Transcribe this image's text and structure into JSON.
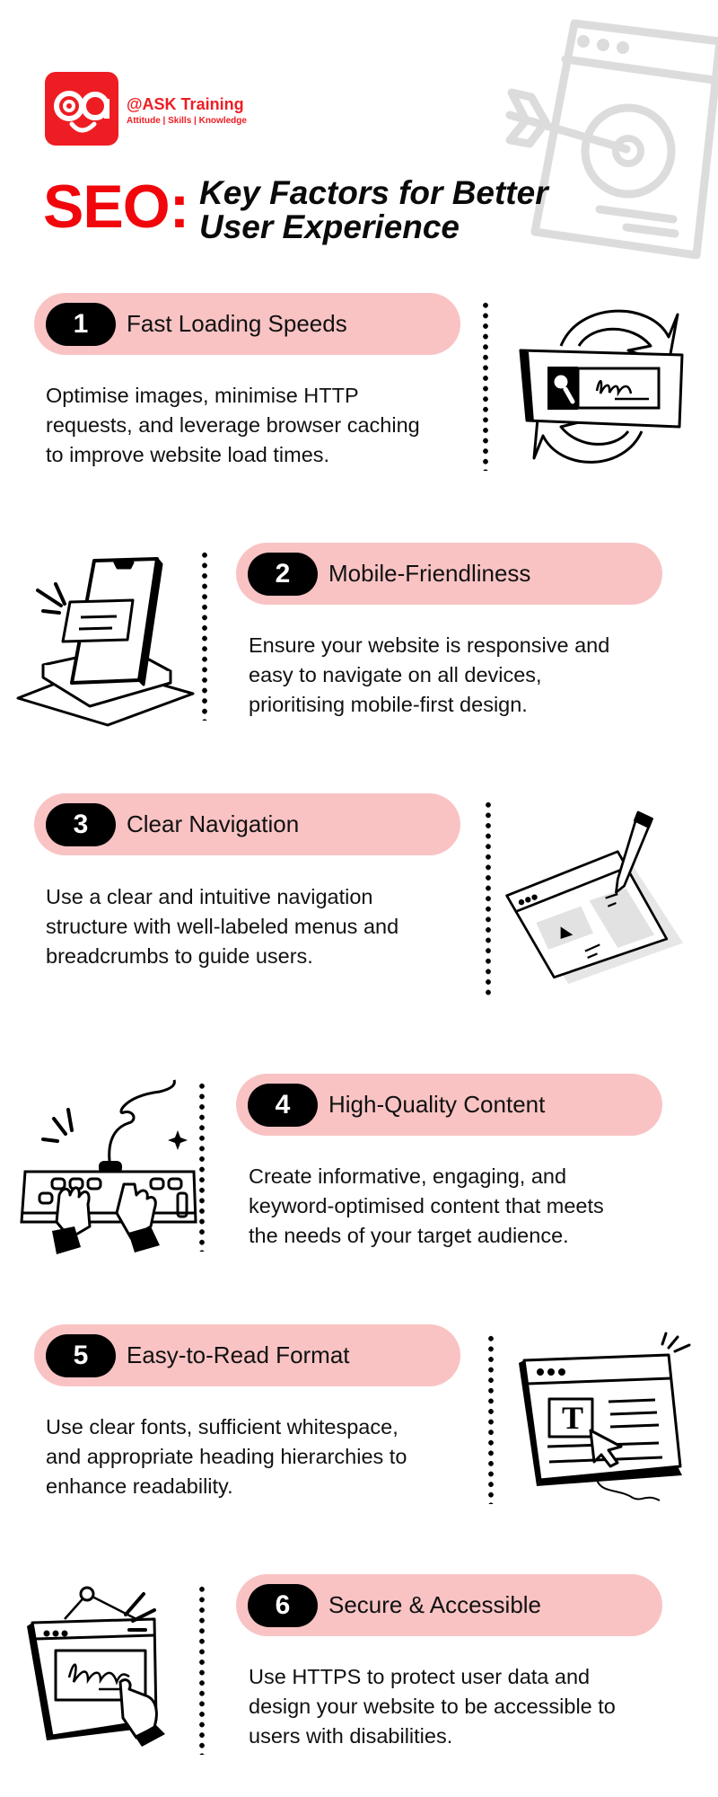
{
  "brand": {
    "logo_mark": "aa",
    "name": "@ASK Training",
    "tagline": "Attitude | Skills | Knowledge",
    "accent_color": "#ee1d23"
  },
  "header": {
    "title_prefix": "SEO:",
    "title_line1": "Key Factors for Better",
    "title_line2": "User Experience",
    "hero_icon": "target-browser-icon"
  },
  "colors": {
    "pill_bg": "#f9c3c4",
    "badge_bg": "#000000",
    "title_red": "#f0060b"
  },
  "sections": [
    {
      "number": "1",
      "title": "Fast Loading Speeds",
      "lines": [
        "Optimise images, minimise HTTP",
        "requests, and leverage browser caching",
        "to improve website load times."
      ],
      "icon": "search-refresh-icon"
    },
    {
      "number": "2",
      "title": "Mobile-Friendliness",
      "lines": [
        "Ensure your website is responsive and",
        "easy to navigate on all devices,",
        "prioritising mobile-first design."
      ],
      "icon": "mobile-phone-icon"
    },
    {
      "number": "3",
      "title": "Clear Navigation",
      "lines": [
        "Use a clear and intuitive navigation",
        "structure with well-labeled menus and",
        "breadcrumbs to guide users."
      ],
      "icon": "browser-pencil-icon"
    },
    {
      "number": "4",
      "title": "High-Quality Content",
      "lines": [
        "Create informative, engaging, and",
        "keyword-optimised content that meets",
        "the needs of your target audience."
      ],
      "icon": "keyboard-typing-icon"
    },
    {
      "number": "5",
      "title": "Easy-to-Read Format",
      "lines": [
        "Use clear fonts, sufficient whitespace,",
        "and appropriate heading hierarchies to",
        "enhance readability."
      ],
      "icon": "text-cursor-browser-icon"
    },
    {
      "number": "6",
      "title": "Secure & Accessible",
      "lines": [
        "Use HTTPS to protect user data and",
        "design your website to be accessible to",
        "users with disabilities."
      ],
      "icon": "signature-touch-icon"
    }
  ]
}
